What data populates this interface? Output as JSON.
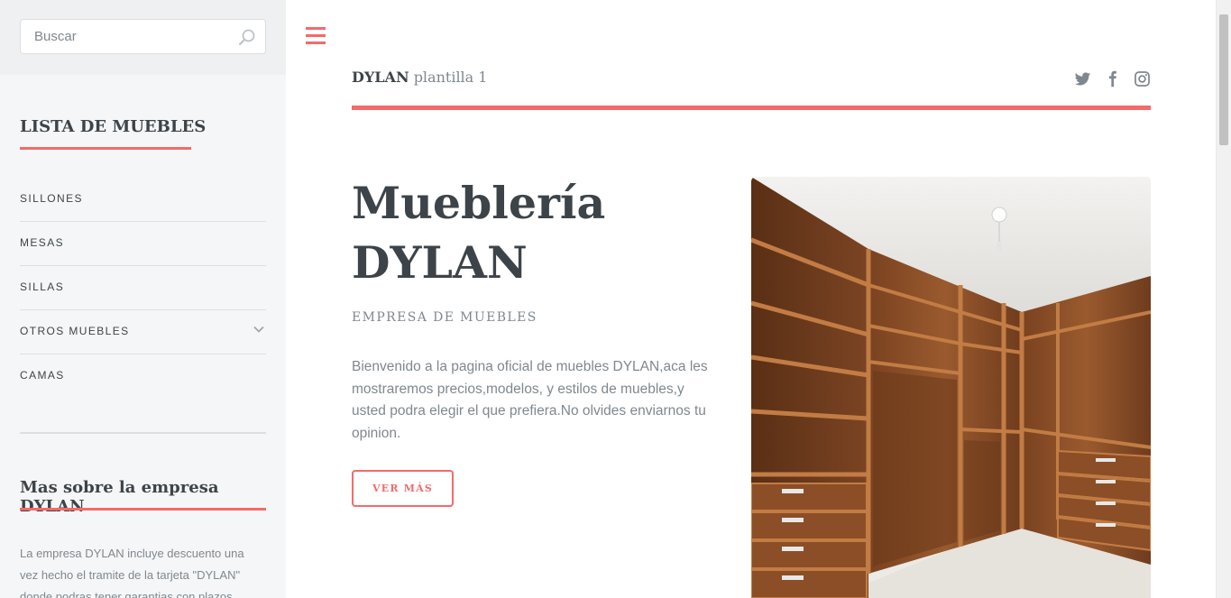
{
  "search": {
    "placeholder": "Buscar"
  },
  "sidebar": {
    "menu_heading": "LISTA DE MUEBLES",
    "menu": [
      {
        "label": "SILLONES"
      },
      {
        "label": "MESAS"
      },
      {
        "label": "SILLAS"
      },
      {
        "label": "OTROS MUEBLES",
        "has_submenu": true
      },
      {
        "label": "CAMAS"
      }
    ],
    "about_heading": "Mas sobre la empresa DYLAN",
    "about_text": "La empresa DYLAN incluye descuento una vez hecho el tramite de la tarjeta \"DYLAN\" donde podras tener garantias con plazos"
  },
  "header": {
    "logo_bold": "DYLAN",
    "logo_sub": "plantilla 1",
    "social": [
      "twitter-icon",
      "facebook-icon",
      "instagram-icon"
    ]
  },
  "hero": {
    "title_line1": "Mueblería",
    "title_line2": "DYLAN",
    "subtitle": "EMPRESA DE MUEBLES",
    "text": "Bienvenido a la pagina oficial de muebles DYLAN,aca les mostraremos precios,modelos, y estilos de muebles,y usted podra elegir el que prefiera.No olvides enviarnos tu opinion.",
    "button": "VER MÁS"
  },
  "colors": {
    "accent": "#f56a6a",
    "text_dark": "#3d4449",
    "text_muted": "#7f888f",
    "sidebar_bg": "#f5f6f7",
    "wood": "#8a4f26"
  }
}
